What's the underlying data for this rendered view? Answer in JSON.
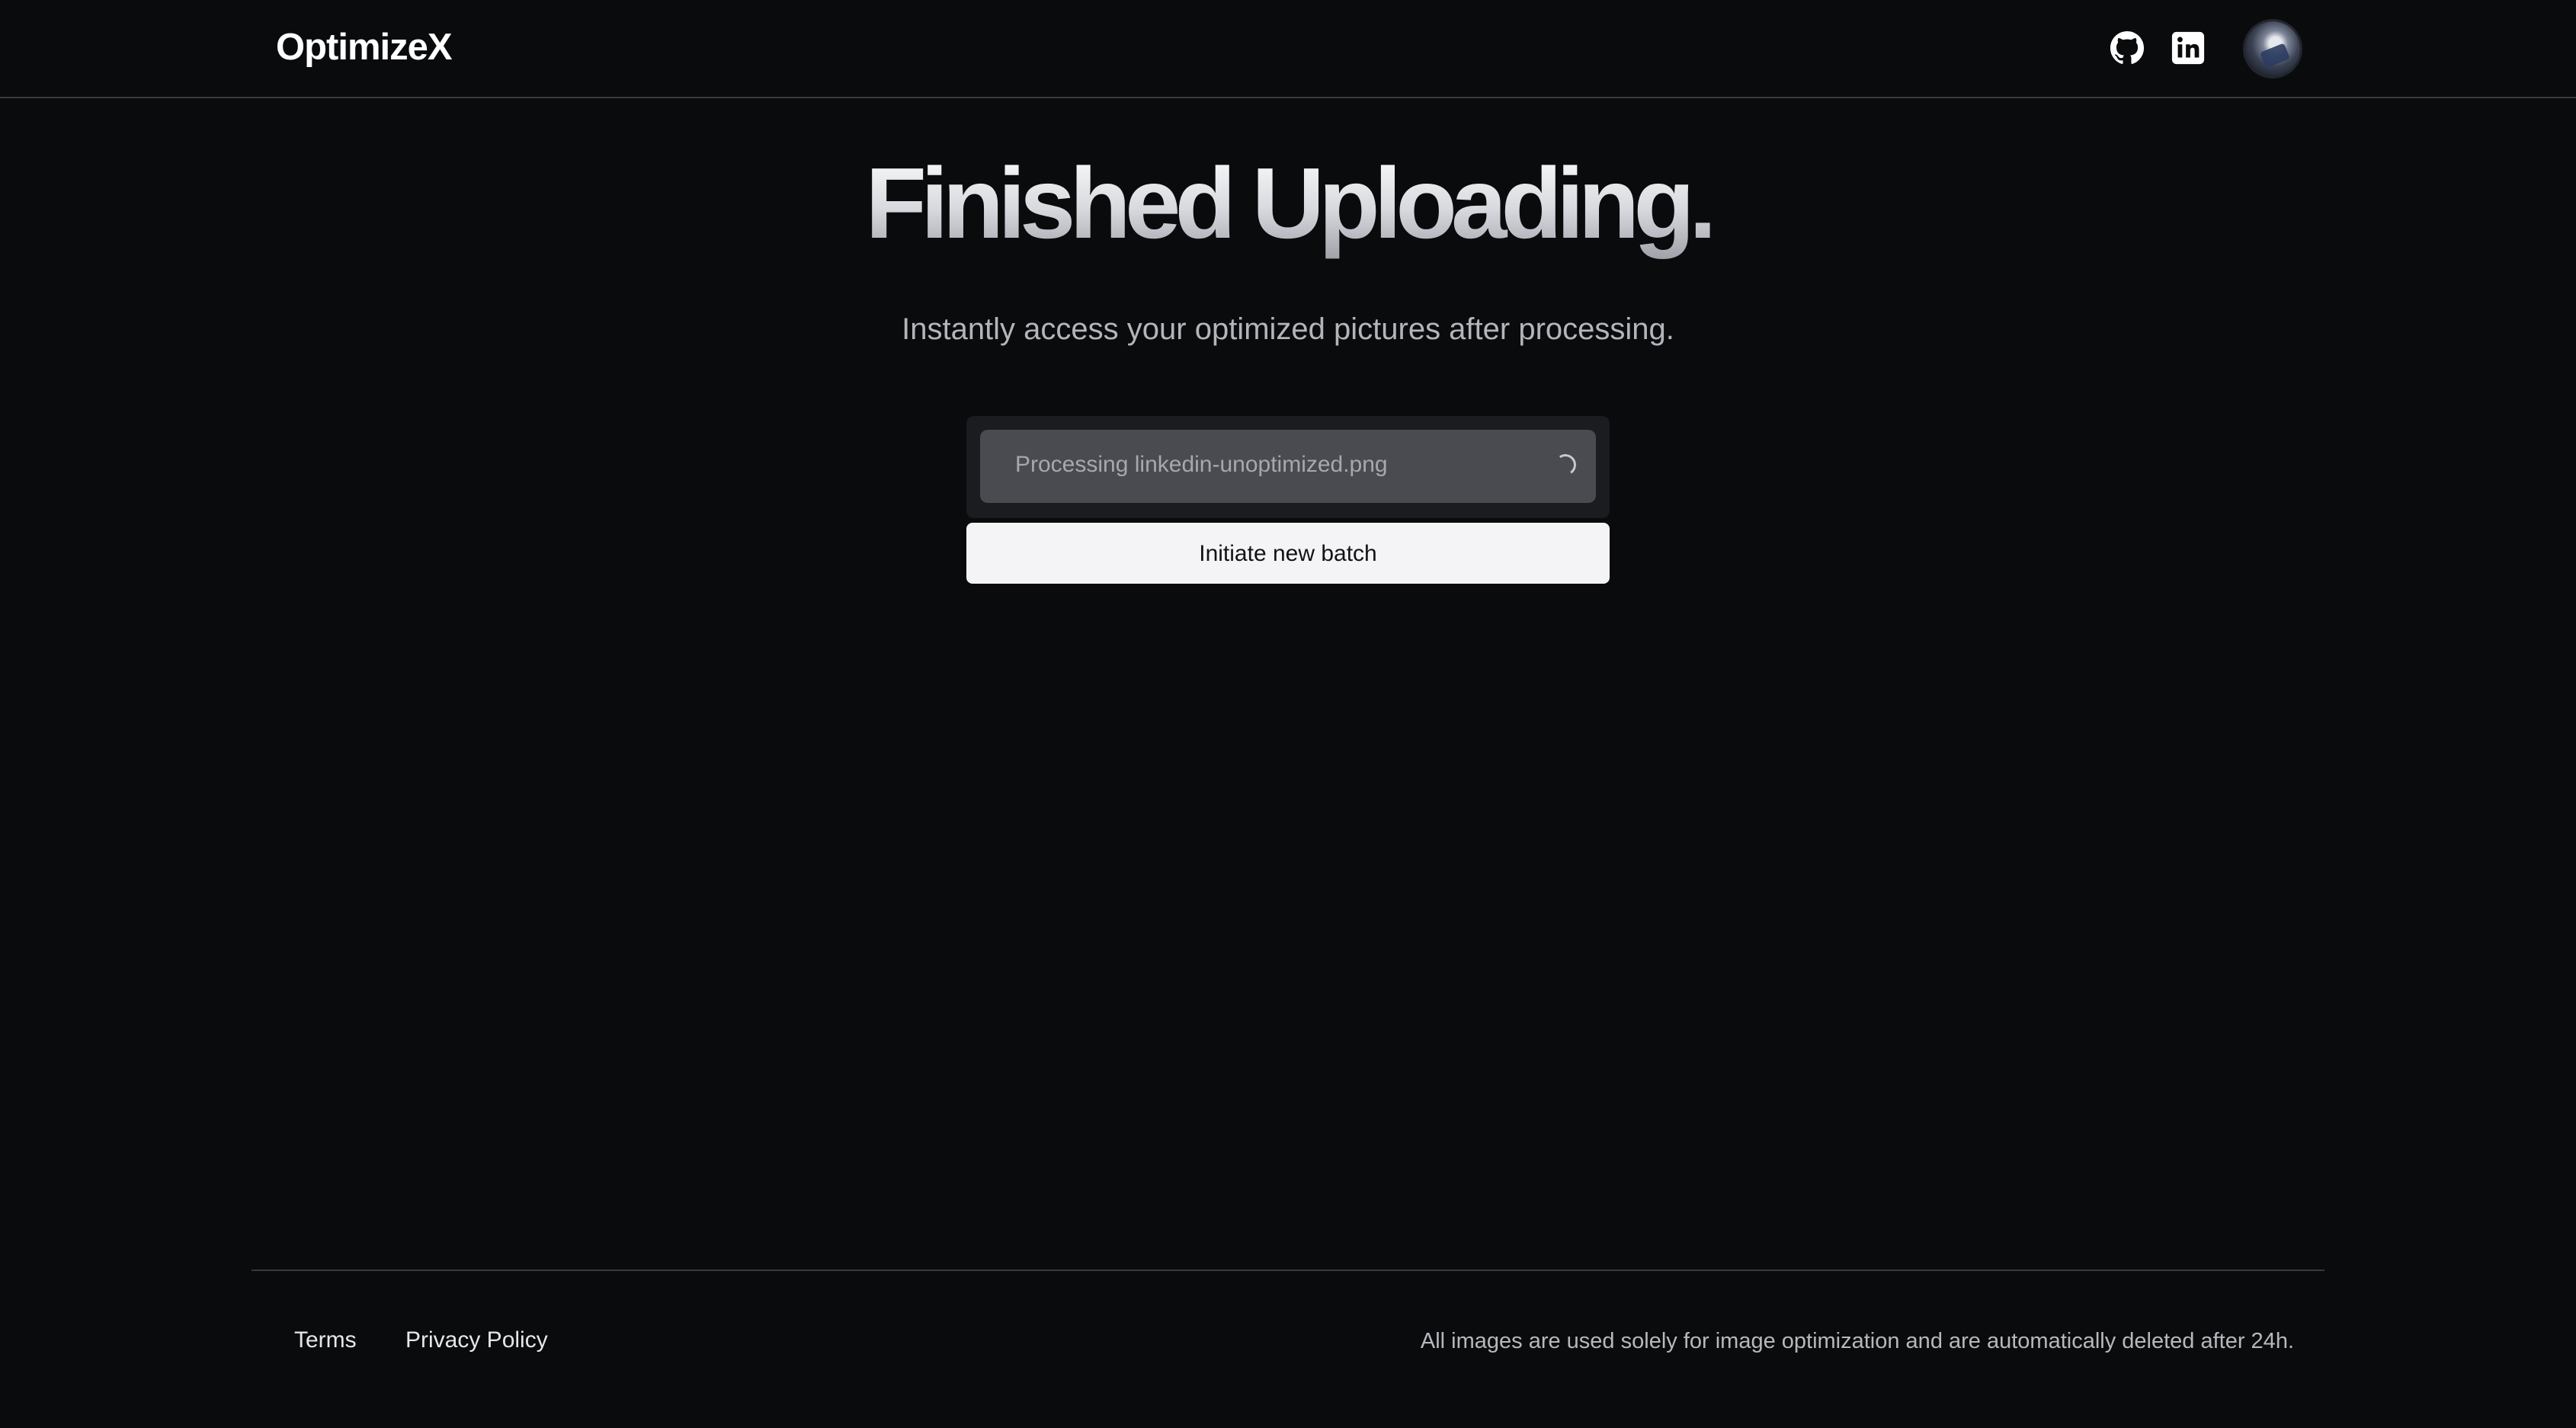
{
  "header": {
    "brand": "OptimizeX",
    "icons": [
      "github-icon",
      "linkedin-icon"
    ],
    "avatar": "user-avatar"
  },
  "hero": {
    "title": "Finished Uploading.",
    "subtitle": "Instantly access your optimized pictures after processing."
  },
  "processing": {
    "items": [
      {
        "label": "Processing linkedin-unoptimized.png",
        "status_icon": "spinner-icon"
      }
    ]
  },
  "actions": {
    "new_batch_label": "Initiate new batch"
  },
  "footer": {
    "links": [
      "Terms",
      "Privacy Policy"
    ],
    "note": "All images are used solely for image optimization and are automatically deleted after 24h."
  },
  "colors": {
    "background": "#0a0b0d",
    "button_bg": "#f4f4f6",
    "card_bg": "#1b1c20",
    "item_bg": "#4a4b50"
  }
}
